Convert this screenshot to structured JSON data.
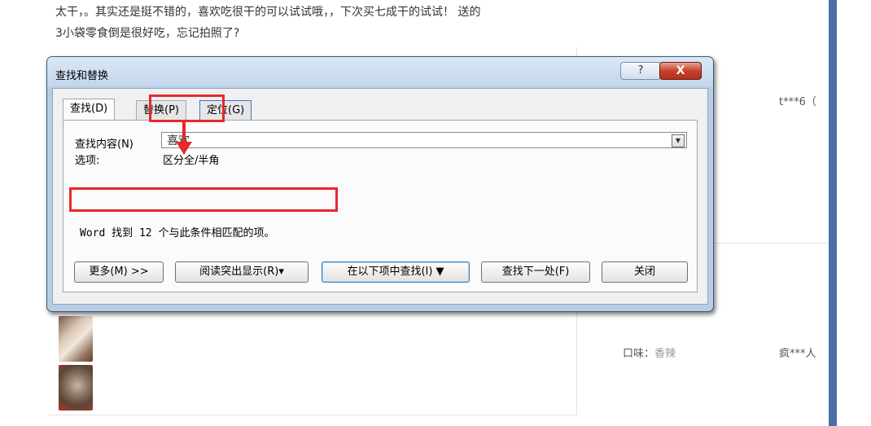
{
  "review": {
    "line1": "太干，。其实还是挺不错的，喜欢吃很干的可以试试哦，，下次买七成干的试试！ 送的",
    "line2": "3小袋零食倒是很好吃，忘记拍照了?"
  },
  "sidebar": {
    "user1": "t***6（",
    "user2": "疯***人",
    "taste_label": "口味：",
    "taste_value": "香辣"
  },
  "dialog": {
    "title": "查找和替换",
    "help_label": "?",
    "close_label": "X",
    "tabs": [
      {
        "label": "查找(D)",
        "active": true
      },
      {
        "label": "替换(P)",
        "active": false
      },
      {
        "label": "定位(G)",
        "active": false
      }
    ],
    "find_label": "查找内容(N)",
    "find_value": "喜欢",
    "options_label": "选项:",
    "options_value": "区分全/半角",
    "result_text": "Word 找到 12 个与此条件相匹配的项。",
    "buttons": {
      "more": "更多(M) >>",
      "highlight": "阅读突出显示(R)▾",
      "find_in": "在以下项中查找(I) ▼",
      "find_next": "查找下一处(F)",
      "close": "关闭"
    }
  },
  "colors": {
    "annotation_red": "#e8282c",
    "dialog_frame": "#b9cde5",
    "right_bar": "#4a6fa8"
  }
}
